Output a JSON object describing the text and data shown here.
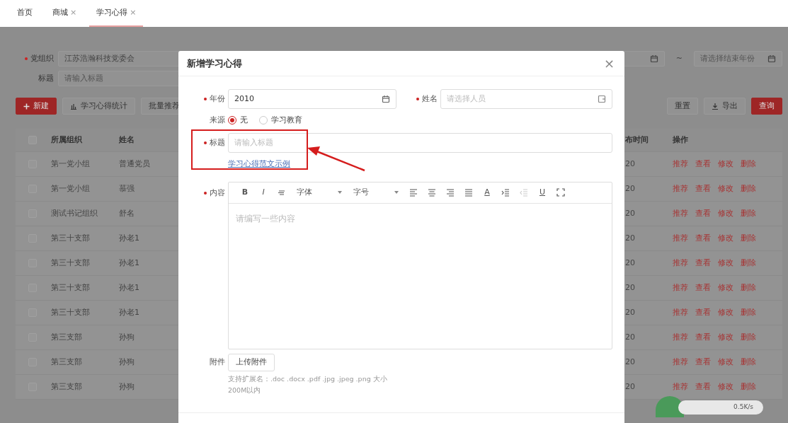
{
  "tabs": [
    {
      "label": "首页",
      "selected": false
    },
    {
      "label": "商城",
      "close": "×",
      "selected": false
    },
    {
      "label": "学习心得",
      "close": "×",
      "selected": true
    }
  ],
  "filters": {
    "org": {
      "label": "党组织",
      "required": true,
      "value": "江苏浩瀚科技党委会"
    },
    "title": {
      "label": "标题",
      "required": false,
      "placeholder": "请输入标题"
    },
    "date_range": {
      "separator": "~",
      "end_placeholder": "请选择结束年份"
    }
  },
  "toolbar_left": [
    {
      "kind": "create",
      "label": "新建"
    },
    {
      "kind": "stats",
      "label": "学习心得统计"
    },
    {
      "kind": "plain",
      "label": "批量推荐"
    }
  ],
  "toolbar_right": [
    {
      "kind": "plain",
      "label": "重置"
    },
    {
      "kind": "export",
      "label": "导出"
    },
    {
      "kind": "primary",
      "label": "查询"
    }
  ],
  "table": {
    "header_checked": false,
    "columns": [
      "所属组织",
      "姓名",
      "布时间",
      "操作"
    ],
    "rows": [
      {
        "checked": false,
        "org": "第一党小组",
        "name": "普通党员",
        "time": "20",
        "actions": [
          "推荐",
          "查看",
          "修改",
          "删除"
        ]
      },
      {
        "checked": false,
        "org": "第一党小组",
        "name": "慕强",
        "time": "20",
        "actions": [
          "推荐",
          "查看",
          "修改",
          "删除"
        ]
      },
      {
        "checked": false,
        "org": "测试书记组织",
        "name": "舒名",
        "time": "20",
        "actions": [
          "推荐",
          "查看",
          "修改",
          "删除"
        ]
      },
      {
        "checked": false,
        "org": "第三十支部",
        "name": "孙老1",
        "time": "20",
        "actions": [
          "推荐",
          "查看",
          "修改",
          "删除"
        ]
      },
      {
        "checked": false,
        "org": "第三十支部",
        "name": "孙老1",
        "time": "20",
        "actions": [
          "推荐",
          "查看",
          "修改",
          "删除"
        ]
      },
      {
        "checked": false,
        "org": "第三十支部",
        "name": "孙老1",
        "time": "20",
        "actions": [
          "推荐",
          "查看",
          "修改",
          "删除"
        ]
      },
      {
        "checked": false,
        "org": "第三十支部",
        "name": "孙老1",
        "time": "20",
        "actions": [
          "推荐",
          "查看",
          "修改",
          "删除"
        ]
      },
      {
        "checked": false,
        "org": "第三支部",
        "name": "孙狗",
        "time": "20",
        "actions": [
          "推荐",
          "查看",
          "修改",
          "删除"
        ]
      },
      {
        "checked": false,
        "org": "第三支部",
        "name": "孙狗",
        "time": "20",
        "actions": [
          "推荐",
          "查看",
          "修改",
          "删除"
        ]
      },
      {
        "checked": false,
        "org": "第三支部",
        "name": "孙狗",
        "time": "20",
        "actions": [
          "推荐",
          "查看",
          "修改",
          "删除"
        ]
      }
    ]
  },
  "net_widget": {
    "speed": "0.5K/s"
  },
  "dialog": {
    "title": "新增学习心得",
    "close": "×",
    "year": {
      "label": "年份",
      "required": true,
      "value": "2010"
    },
    "person": {
      "label": "姓名",
      "required": true,
      "placeholder": "请选择人员"
    },
    "source": {
      "label": "来源",
      "options": [
        {
          "label": "无",
          "selected": true
        },
        {
          "label": "学习教育",
          "selected": false
        }
      ]
    },
    "title_field": {
      "label": "标题",
      "required": true,
      "placeholder": "请输入标题",
      "link": "学习心得范文示例"
    },
    "content": {
      "label": "内容",
      "required": true,
      "placeholder": "请编写一些内容",
      "tools": [
        {
          "kind": "bold",
          "label": "B",
          "disabled": false
        },
        {
          "kind": "italic",
          "label": "I",
          "disabled": false
        },
        {
          "kind": "strike",
          "disabled": false
        },
        {
          "kind": "select",
          "label": "字体",
          "disabled": false
        },
        {
          "kind": "select",
          "label": "字号",
          "disabled": false
        },
        {
          "kind": "align-left",
          "disabled": false
        },
        {
          "kind": "align-center",
          "disabled": false
        },
        {
          "kind": "align-right",
          "disabled": false
        },
        {
          "kind": "justify",
          "disabled": false
        },
        {
          "kind": "color",
          "label": "A",
          "disabled": false
        },
        {
          "kind": "indent",
          "disabled": false
        },
        {
          "kind": "outdent",
          "disabled": true
        },
        {
          "kind": "underline",
          "label": "U",
          "disabled": false
        },
        {
          "kind": "fullscreen",
          "disabled": false
        }
      ]
    },
    "attachment": {
      "label": "附件",
      "button": "上传附件",
      "hint": "支持扩展名：.doc .docx .pdf .jpg .jpeg .png 大小 200M以内"
    }
  }
}
